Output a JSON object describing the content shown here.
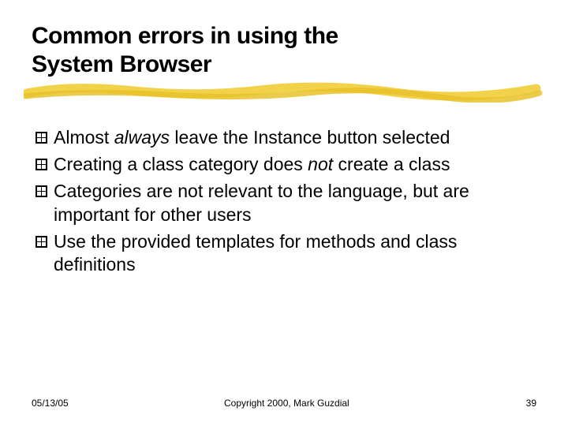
{
  "title_line1": "Common errors in using the",
  "title_line2": "System Browser",
  "bullets": [
    {
      "pre": "Almost ",
      "em": "always",
      "post": " leave the Instance button selected"
    },
    {
      "pre": "Creating a class category does ",
      "em": "not",
      "post": " create a class"
    },
    {
      "pre": "Categories are not relevant to the language, but are important for other users",
      "em": "",
      "post": ""
    },
    {
      "pre": "Use the provided templates for methods and class definitions",
      "em": "",
      "post": ""
    }
  ],
  "footer": {
    "date": "05/13/05",
    "copyright": "Copyright 2000, Mark Guzdial",
    "page": "39"
  }
}
